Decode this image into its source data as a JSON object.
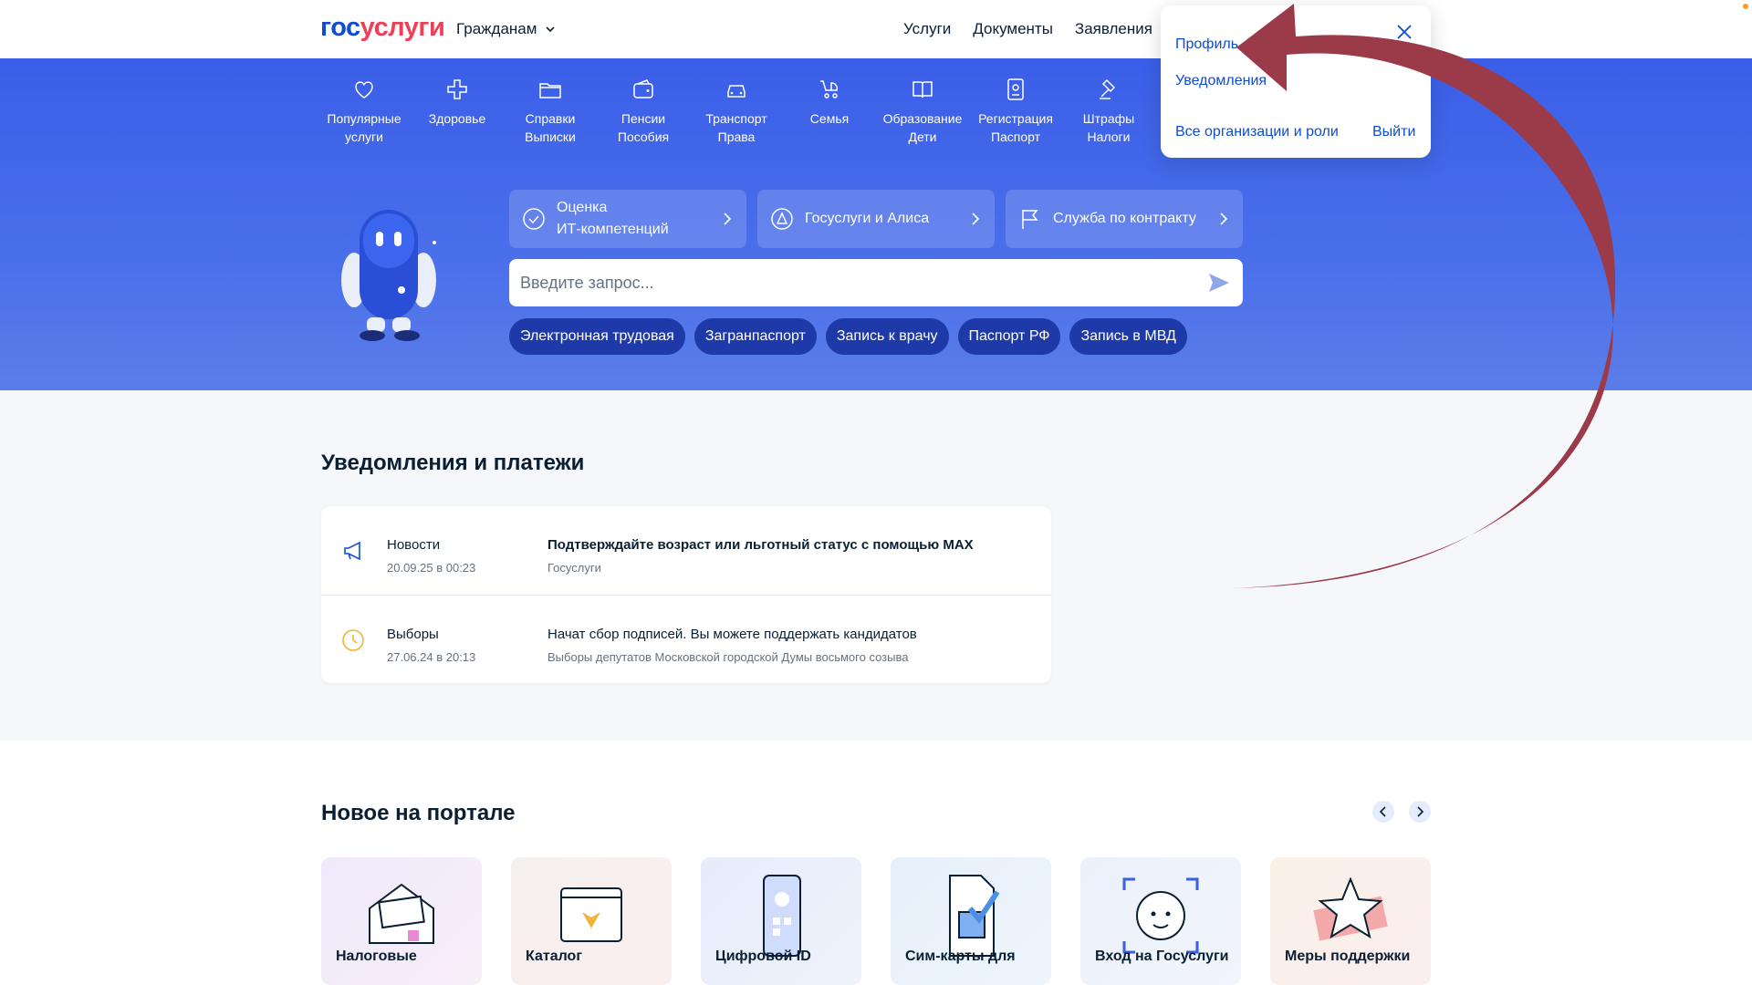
{
  "header": {
    "logo_a": "гос",
    "logo_b": "услуги",
    "audience": "Гражданам",
    "nav": [
      "Услуги",
      "Документы",
      "Заявления"
    ]
  },
  "profile_menu": {
    "profile": "Профиль",
    "notifications": "Уведомления",
    "all_orgs": "Все организации и роли",
    "logout": "Выйти"
  },
  "categories": [
    {
      "icon": "heart-icon",
      "l1": "Популярные",
      "l2": "услуги"
    },
    {
      "icon": "cross-icon",
      "l1": "Здоровье",
      "l2": ""
    },
    {
      "icon": "folder-icon",
      "l1": "Справки",
      "l2": "Выписки"
    },
    {
      "icon": "wallet-icon",
      "l1": "Пенсии",
      "l2": "Пособия"
    },
    {
      "icon": "car-icon",
      "l1": "Транспорт",
      "l2": "Права"
    },
    {
      "icon": "stroller-icon",
      "l1": "Семья",
      "l2": ""
    },
    {
      "icon": "book-icon",
      "l1": "Образование",
      "l2": "Дети"
    },
    {
      "icon": "passport-icon",
      "l1": "Регистрация",
      "l2": "Паспорт"
    },
    {
      "icon": "gavel-icon",
      "l1": "Штрафы",
      "l2": "Налоги"
    }
  ],
  "promos": {
    "it": {
      "l1": "Оценка",
      "l2": "ИТ-компетенций"
    },
    "alice": "Госуслуги и Алиса",
    "contract": "Служба по контракту"
  },
  "search": {
    "placeholder": "Введите запрос..."
  },
  "chips": [
    "Электронная трудовая",
    "Загранпаспорт",
    "Запись к врачу",
    "Паспорт РФ",
    "Запись в МВД"
  ],
  "notifications": {
    "heading": "Уведомления и платежи",
    "items": [
      {
        "icon": "megaphone-icon",
        "type": "Новости",
        "date": "20.09.25 в 00:23",
        "title": "Подтверждайте возраст или льготный статус с помощью MAX",
        "sub": "Госуслуги"
      },
      {
        "icon": "clock-icon",
        "type": "Выборы",
        "date": "27.06.24 в 20:13",
        "title": "Начат сбор подписей. Вы можете поддержать кандидатов",
        "sub": "Выборы депутатов Московской городской Думы восьмого созыва"
      }
    ]
  },
  "new_portal": {
    "heading": "Новое на портале",
    "tiles": [
      "Налоговые",
      "Каталог",
      "Цифровой ID",
      "Сим-карты для",
      "Вход на Госуслуги",
      "Меры поддержки"
    ]
  },
  "colors": {
    "brand_blue": "#0d4cd3",
    "brand_red": "#ee3f58",
    "hero_blue": "#3a5ee8",
    "chip_blue": "#1e3aa8",
    "annotation_arrow": "#9b3a48"
  }
}
